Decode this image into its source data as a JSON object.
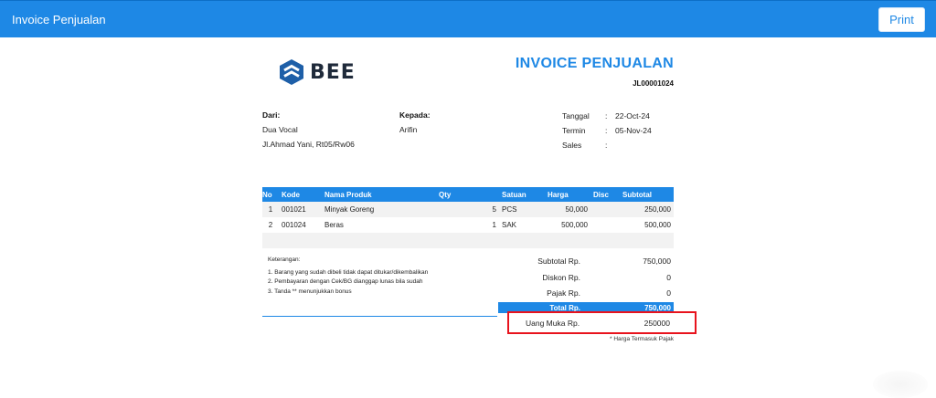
{
  "topbar": {
    "title": "Invoice Penjualan",
    "print_label": "Print"
  },
  "brand": {
    "logo_text": "BEE"
  },
  "invoice": {
    "title": "INVOICE PENJUALAN",
    "number": "JL00001024"
  },
  "from": {
    "label": "Dari:",
    "name": "Dua Vocal",
    "address": "Jl.Ahmad Yani, Rt05/Rw06"
  },
  "to": {
    "label": "Kepada:",
    "name": "Arifin"
  },
  "meta": [
    {
      "key": "Tanggal",
      "colon": ":",
      "value": "22-Oct-24"
    },
    {
      "key": "Termin",
      "colon": ":",
      "value": "05-Nov-24"
    },
    {
      "key": "Sales",
      "colon": ":",
      "value": ""
    }
  ],
  "table": {
    "headers": {
      "no": "No",
      "kode": "Kode",
      "nama": "Nama Produk",
      "qty": "Qty",
      "satuan": "Satuan",
      "harga": "Harga",
      "disc": "Disc",
      "subtotal": "Subtotal"
    },
    "rows": [
      {
        "no": "1",
        "kode": "001021",
        "nama": "Minyak Goreng",
        "qty": "5",
        "satuan": "PCS",
        "harga": "50,000",
        "disc": "",
        "subtotal": "250,000"
      },
      {
        "no": "2",
        "kode": "001024",
        "nama": "Beras",
        "qty": "1",
        "satuan": "SAK",
        "harga": "500,000",
        "disc": "",
        "subtotal": "500,000"
      }
    ]
  },
  "notes": {
    "heading": "Keterangan:",
    "lines": [
      "1. Barang yang sudah dibeli tidak dapat ditukar/dikembalikan",
      "2. Pembayaran dengan Cek/BG dianggap lunas bila sudah",
      "3. Tanda ** menunjukkan bonus"
    ]
  },
  "summary": {
    "subtotal_label": "Subtotal Rp.",
    "subtotal_value": "750,000",
    "diskon_label": "Diskon Rp.",
    "diskon_value": "0",
    "pajak_label": "Pajak Rp.",
    "pajak_value": "0",
    "total_label": "Total Rp.",
    "total_value": "750,000",
    "uang_muka_label": "Uang Muka Rp.",
    "uang_muka_value": "250000"
  },
  "tax_note": "* Harga Termasuk Pajak",
  "colors": {
    "primary": "#1e88e5",
    "highlight": "#e8131d",
    "logo_dark": "#1f2a3a"
  }
}
